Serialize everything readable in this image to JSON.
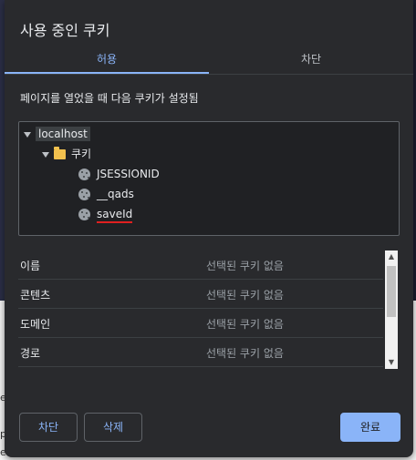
{
  "dialog": {
    "title": "사용 중인 쿠키",
    "tabs": [
      {
        "label": "허용",
        "active": true
      },
      {
        "label": "차단",
        "active": false
      }
    ],
    "description": "페이지를 열었을 때 다음 쿠키가 설정됨"
  },
  "tree": {
    "host": "localhost",
    "folder": "쿠키",
    "cookies": [
      "JSESSIONID",
      "__qads",
      "saveId"
    ]
  },
  "details": [
    {
      "key": "이름",
      "value": "선택된 쿠키 없음"
    },
    {
      "key": "콘텐츠",
      "value": "선택된 쿠키 없음"
    },
    {
      "key": "도메인",
      "value": "선택된 쿠키 없음"
    },
    {
      "key": "경로",
      "value": "선택된 쿠키 없음"
    }
  ],
  "buttons": {
    "block": "차단",
    "delete": "삭제",
    "done": "완료"
  },
  "colors": {
    "accent": "#8ab4f8",
    "dialog_bg": "#292a2d",
    "annotation": "#e02020"
  },
  "backdrop": {
    "edge_chars": [
      "e",
      "p",
      "e"
    ]
  }
}
